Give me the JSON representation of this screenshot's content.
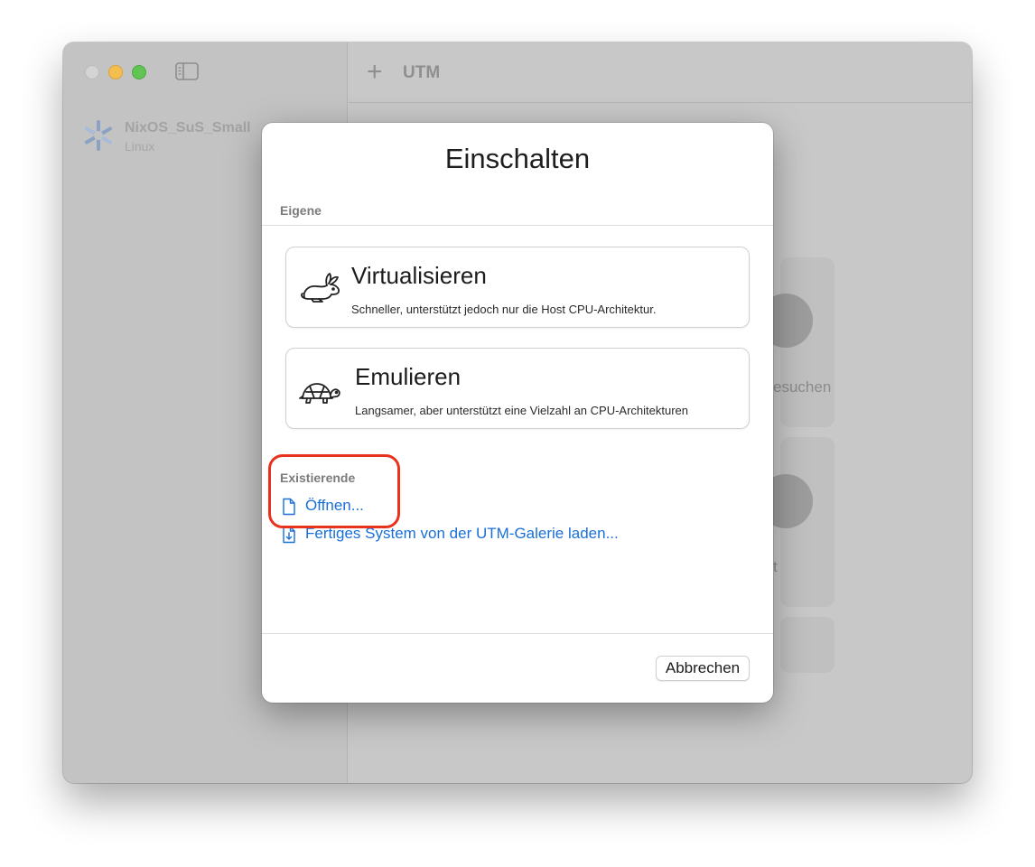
{
  "window": {
    "title": "UTM"
  },
  "sidebar": {
    "vm_items": [
      {
        "name": "NixOS_SuS_Small",
        "os": "Linux"
      }
    ]
  },
  "background_main": {
    "partial_texts": [
      "esuchen",
      "t"
    ]
  },
  "dialog": {
    "title": "Einschalten",
    "section_custom": "Eigene",
    "options": [
      {
        "title": "Virtualisieren",
        "description": "Schneller, unterstützt jedoch nur die Host CPU-Architektur.",
        "icon": "rabbit-icon"
      },
      {
        "title": "Emulieren",
        "description": "Langsamer, aber unterstützt eine Vielzahl an CPU-Architekturen",
        "icon": "turtle-icon"
      }
    ],
    "section_existing": "Existierende",
    "links": [
      {
        "label": "Öffnen...",
        "icon": "document-icon"
      },
      {
        "label": "Fertiges System von der UTM-Galerie laden...",
        "icon": "download-document-icon"
      }
    ],
    "cancel_label": "Abbrechen"
  },
  "colors": {
    "link": "#1a6fd8",
    "highlight": "#e8321c",
    "traffic_close": "#d4d4d4",
    "traffic_min": "#f5bf4f",
    "traffic_max": "#61c554"
  }
}
